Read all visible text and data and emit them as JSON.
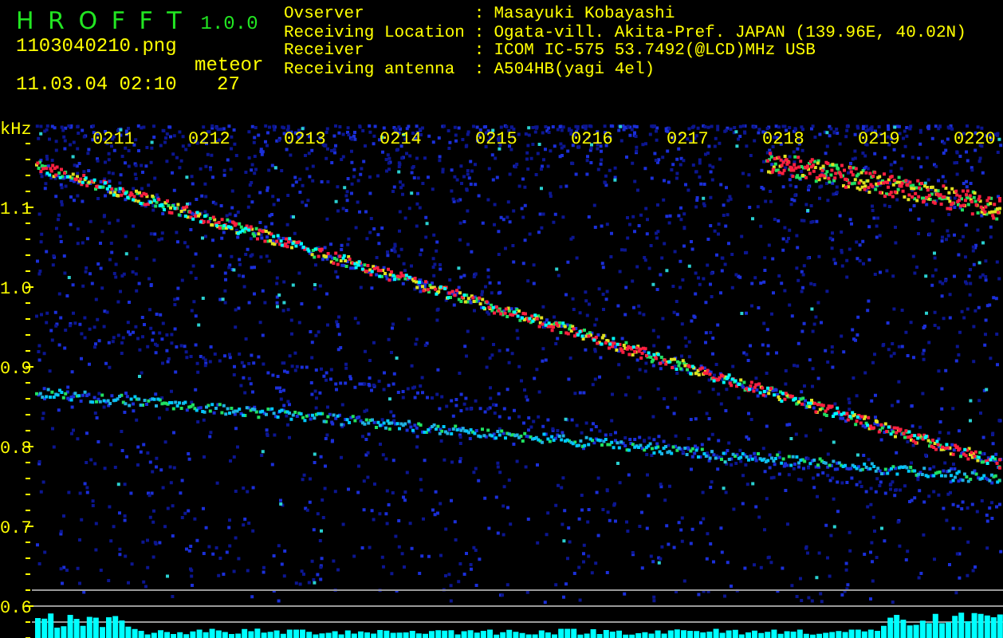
{
  "app": {
    "name": "H R O F F T",
    "version": "1.0.0"
  },
  "file": "1103040210.png",
  "datetime": "11.03.04 02:10",
  "meteor": {
    "label": "meteor",
    "count": "27"
  },
  "info": [
    {
      "label": "Ovserver",
      "separator": ":",
      "value": "Masayuki Kobayashi"
    },
    {
      "label": "Receiving Location",
      "separator": ":",
      "value": "Ogata-vill. Akita-Pref. JAPAN (139.96E, 40.02N)"
    },
    {
      "label": "Receiver",
      "separator": ":",
      "value": "ICOM IC-575 53.7492(@LCD)MHz USB"
    },
    {
      "label": "Receiving antenna",
      "separator": ":",
      "value": "A504HB(yagi 4el)"
    }
  ],
  "plot": {
    "unit": "kHz",
    "frequency_labels": [
      "1.1",
      "1.0",
      "0.9",
      "0.8",
      "0.7",
      "0.6"
    ],
    "time_labels": [
      "0211",
      "0212",
      "0213",
      "0214",
      "0215",
      "0216",
      "0217",
      "0218",
      "0219",
      "0220"
    ]
  }
}
